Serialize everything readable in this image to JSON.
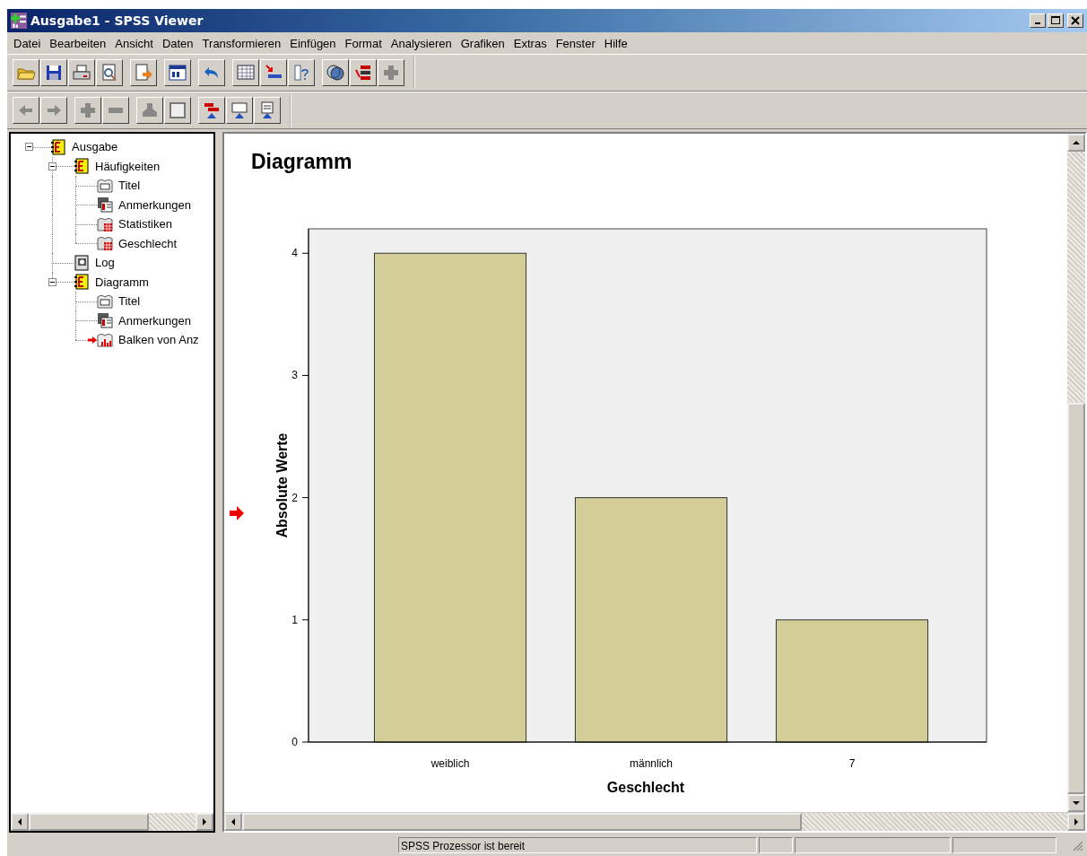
{
  "window": {
    "title": "Ausgabe1 - SPSS Viewer"
  },
  "menu": [
    "Datei",
    "Bearbeiten",
    "Ansicht",
    "Daten",
    "Transformieren",
    "Einfügen",
    "Format",
    "Analysieren",
    "Grafiken",
    "Extras",
    "Fenster",
    "Hilfe"
  ],
  "outline": [
    {
      "label": "Ausgabe",
      "kind": "heading",
      "expanded": true,
      "current": false,
      "children": [
        {
          "label": "Häufigkeiten",
          "kind": "heading",
          "expanded": true,
          "current": false,
          "children": [
            {
              "label": "Titel",
              "kind": "title",
              "current": false
            },
            {
              "label": "Anmerkungen",
              "kind": "notes",
              "current": false
            },
            {
              "label": "Statistiken",
              "kind": "table",
              "current": false
            },
            {
              "label": "Geschlecht",
              "kind": "table",
              "current": false
            }
          ]
        },
        {
          "label": "Log",
          "kind": "log",
          "current": false
        },
        {
          "label": "Diagramm",
          "kind": "heading",
          "expanded": true,
          "current": false,
          "children": [
            {
              "label": "Titel",
              "kind": "title",
              "current": false
            },
            {
              "label": "Anmerkungen",
              "kind": "notes",
              "current": false
            },
            {
              "label": "Balken von Anz",
              "kind": "chart",
              "current": true
            }
          ]
        }
      ]
    }
  ],
  "output": {
    "heading": "Diagramm",
    "current": true,
    "chart_data": {
      "type": "bar",
      "xlabel": "Geschlecht",
      "ylabel": "Absolute Werte",
      "categories": [
        "weiblich",
        "männlich",
        "7"
      ],
      "values": [
        4,
        2,
        1
      ],
      "ylim": [
        0,
        4.2
      ],
      "yticks": [
        0,
        1,
        2,
        3,
        4
      ]
    }
  },
  "status_bar": {
    "message": "SPSS Prozessor ist bereit"
  }
}
